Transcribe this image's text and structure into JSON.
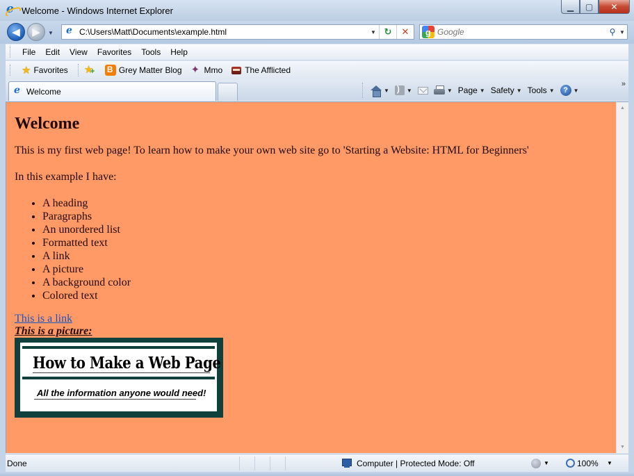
{
  "window": {
    "title": "Welcome - Windows Internet Explorer",
    "min_label": "▁",
    "max_label": "▢",
    "close_label": "✕"
  },
  "address": {
    "url": "C:\\Users\\Matt\\Documents\\example.html"
  },
  "search": {
    "placeholder": "Google",
    "engine_icon": "google-icon"
  },
  "menu": {
    "items": [
      {
        "label": "File"
      },
      {
        "label": "Edit"
      },
      {
        "label": "View"
      },
      {
        "label": "Favorites"
      },
      {
        "label": "Tools"
      },
      {
        "label": "Help"
      }
    ]
  },
  "favorites_bar": {
    "favorites_label": "Favorites",
    "links": [
      {
        "label": "Grey Matter Blog",
        "icon": "blogger-icon"
      },
      {
        "label": "Mmo",
        "icon": "mmo-icon"
      },
      {
        "label": "The Afflicted",
        "icon": "afflicted-icon"
      }
    ]
  },
  "tabs": {
    "active_label": "Welcome"
  },
  "command_bar": {
    "page_label": "Page",
    "safety_label": "Safety",
    "tools_label": "Tools"
  },
  "page": {
    "background_color": "#ff9966",
    "heading": "Welcome",
    "intro": "This is my first web page! To learn how to make your own web site go to 'Starting a Website: HTML for Beginners'",
    "example_intro": "In this example I have:",
    "list": [
      "A heading",
      "Paragraphs",
      "An unordered list",
      "Formatted text",
      "A link",
      "A picture",
      "A background color",
      "Colored text"
    ],
    "link_text": "This is a link",
    "picture_caption": "This is a picture:",
    "picture": {
      "headline": "How to Make a Web Page",
      "tagline": "All the information anyone would need!",
      "border_color": "#10403b"
    }
  },
  "status": {
    "text": "Done",
    "zone": "Computer | Protected Mode: Off",
    "zoom": "100%"
  }
}
